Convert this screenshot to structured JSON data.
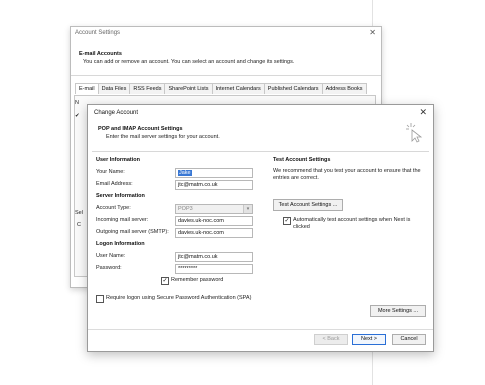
{
  "account_settings": {
    "title": "Account Settings",
    "close_glyph": "✕",
    "heading": "E-mail Accounts",
    "subheading": "You can add or remove an account. You can select an account and change its settings.",
    "tabs": [
      "E-mail",
      "Data Files",
      "RSS Feeds",
      "SharePoint Lists",
      "Internet Calendars",
      "Published Calendars",
      "Address Books"
    ],
    "left_fragments": [
      "N",
      "✔",
      "Sel",
      "C"
    ]
  },
  "change_account": {
    "title": "Change Account",
    "close_glyph": "✕",
    "heading": "POP and IMAP Account Settings",
    "subheading": "Enter the mail server settings for your account.",
    "user_info": {
      "section": "User Information",
      "your_name_label": "Your Name:",
      "your_name_value": "Jake",
      "email_label": "Email Address:",
      "email_value": "jtc@matm.co.uk"
    },
    "server_info": {
      "section": "Server Information",
      "account_type_label": "Account Type:",
      "account_type_value": "POP3",
      "incoming_label": "Incoming mail server:",
      "incoming_value": "davies.uk-noc.com",
      "outgoing_label": "Outgoing mail server (SMTP):",
      "outgoing_value": "davies.uk-noc.com"
    },
    "logon_info": {
      "section": "Logon Information",
      "username_label": "User Name:",
      "username_value": "jtc@matm.co.uk",
      "password_label": "Password:",
      "password_value": "*********",
      "remember_label": "Remember password",
      "remember_checked": true,
      "spa_label": "Require logon using Secure Password Authentication (SPA)",
      "spa_checked": false
    },
    "test": {
      "section": "Test Account Settings",
      "description": "We recommend that you test your account to ensure that the entries are correct.",
      "button_label": "Test Account Settings ...",
      "auto_label": "Automatically test account settings when Next is clicked",
      "auto_checked": true
    },
    "more_settings_label": "More Settings ...",
    "footer": {
      "back_label": "< Back",
      "next_label": "Next >",
      "cancel_label": "Cancel"
    }
  }
}
